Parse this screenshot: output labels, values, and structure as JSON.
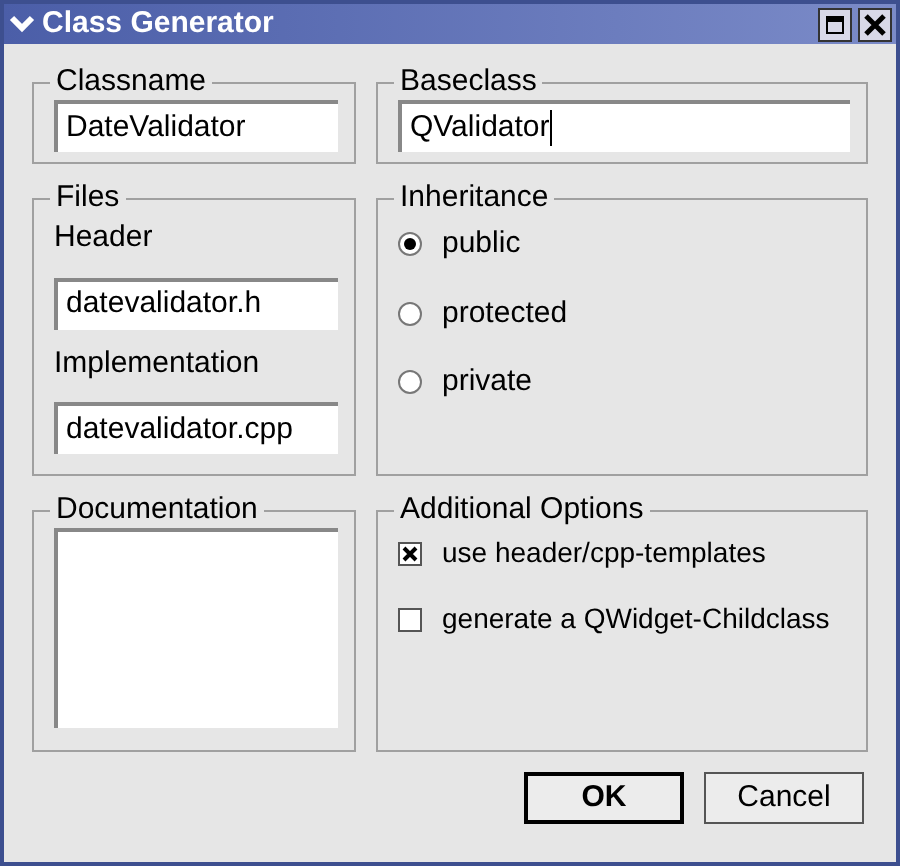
{
  "window": {
    "title": "Class Generator"
  },
  "classname": {
    "label": "Classname",
    "value": "DateValidator",
    "focused": false
  },
  "baseclass": {
    "label": "Baseclass",
    "value": "QValidator",
    "focused": true
  },
  "files": {
    "label": "Files",
    "fields": [
      {
        "label": "Header",
        "value": "datevalidator.h"
      },
      {
        "label": "Implementation",
        "value": "datevalidator.cpp"
      }
    ]
  },
  "inheritance": {
    "label": "Inheritance",
    "options": [
      {
        "label": "public",
        "selected": true
      },
      {
        "label": "protected",
        "selected": false
      },
      {
        "label": "private",
        "selected": false
      }
    ]
  },
  "documentation": {
    "label": "Documentation"
  },
  "additional_options": {
    "label": "Additional Options",
    "options": [
      {
        "label": "use header/cpp-templates",
        "checked": true
      },
      {
        "label": "generate a QWidget-Childclass",
        "checked": false
      }
    ]
  },
  "buttons": [
    {
      "label": "OK",
      "kind": "default"
    },
    {
      "label": "Cancel",
      "kind": "normal"
    }
  ]
}
